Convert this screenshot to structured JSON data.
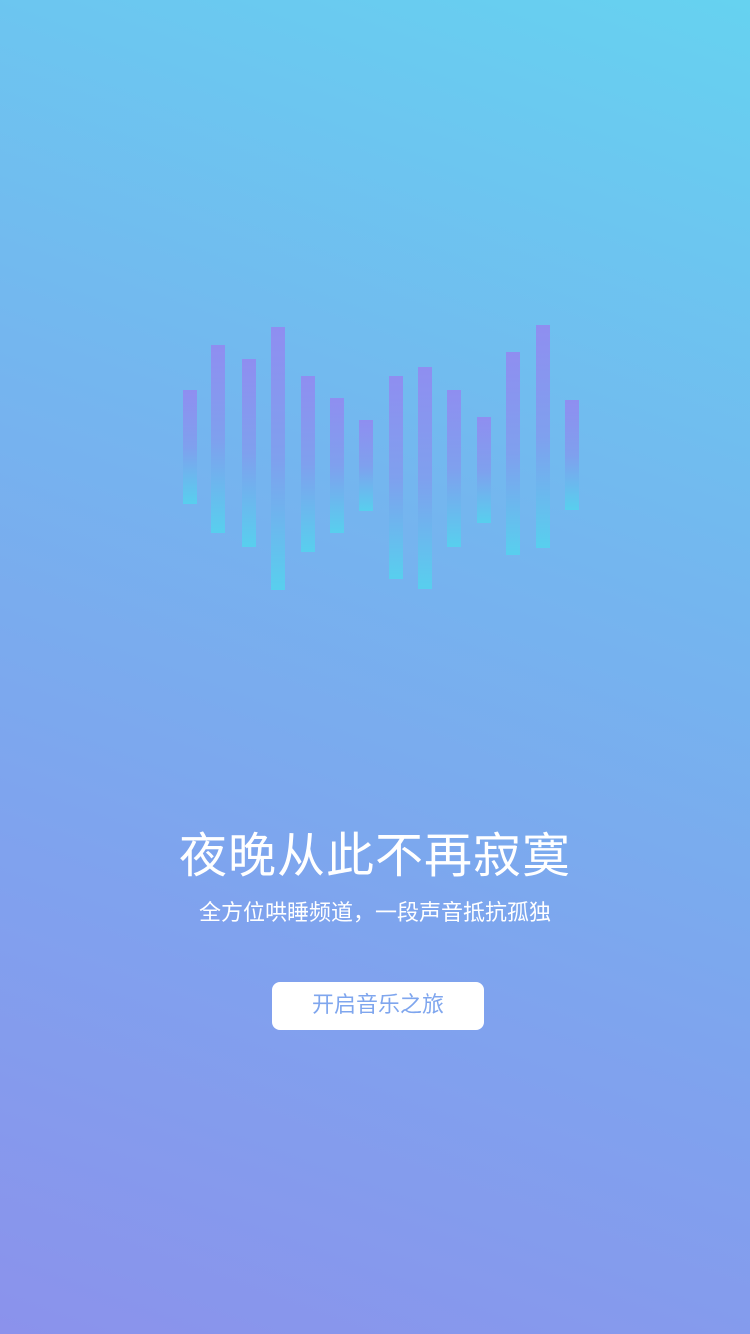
{
  "splash": {
    "headline": "夜晚从此不再寂寞",
    "subline": "全方位哄睡频道，一段声音抵抗孤独",
    "cta_label": "开启音乐之旅"
  },
  "waveform": {
    "icon": "sound-waveform-icon",
    "colors": {
      "bar_top": "#8f8ef0",
      "bar_bottom": "#58cfee"
    }
  },
  "colors": {
    "background_top": "#66d2f0",
    "background_bottom": "#8b92ec",
    "button_background": "#ffffff",
    "button_text": "#7fa6ee",
    "text": "#ffffff"
  }
}
